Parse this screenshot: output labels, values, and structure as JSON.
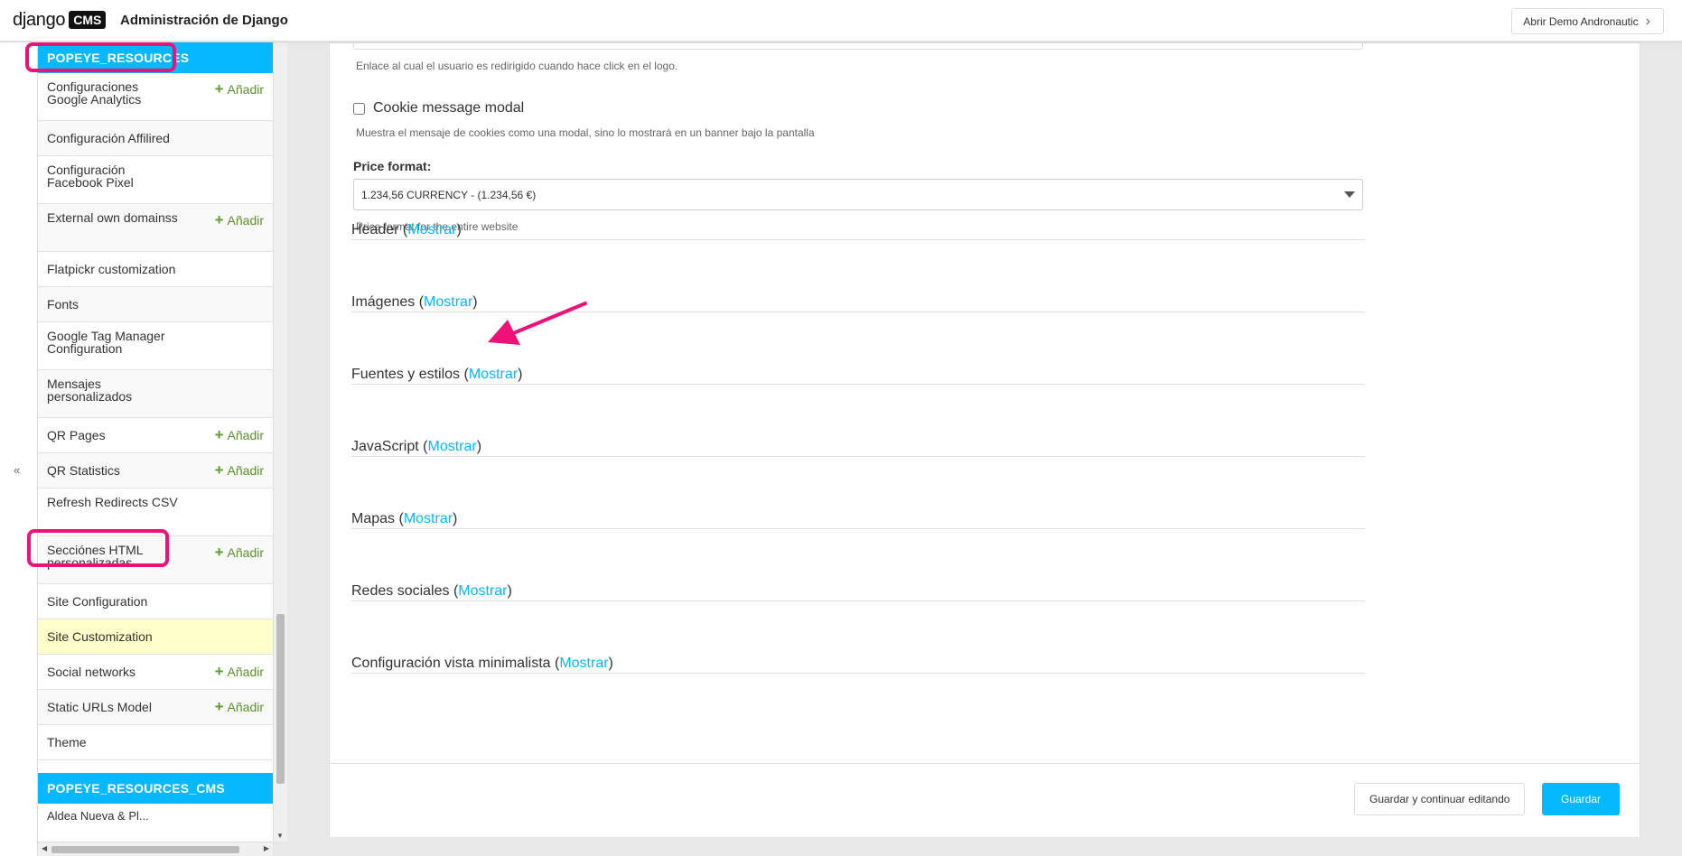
{
  "header": {
    "logo_text": "django",
    "logo_badge": "CMS",
    "title": "Administración de Django",
    "open_site_label": "Abrir Demo Andronautic",
    "open_site_icon": "chevron-right-icon"
  },
  "sidebar": {
    "collapse_label": "«",
    "add_label": "Añadir",
    "section1": {
      "caption": "POPEYE_RESOURCES",
      "items": [
        {
          "label": "Configuraciones Google Analytics",
          "add": true
        },
        {
          "label": "Configuración Affilired",
          "add": false
        },
        {
          "label": "Configuración Facebook Pixel",
          "add": false
        },
        {
          "label": "External own domainss",
          "add": true
        },
        {
          "label": "Flatpickr customization",
          "add": false
        },
        {
          "label": "Fonts",
          "add": false
        },
        {
          "label": "Google Tag Manager Configuration",
          "add": false
        },
        {
          "label": "Mensajes personalizados",
          "add": false
        },
        {
          "label": "QR Pages",
          "add": true
        },
        {
          "label": "QR Statistics",
          "add": true
        },
        {
          "label": "Refresh Redirects CSV",
          "add": false
        },
        {
          "label": "Secciónes HTML personalizadas",
          "add": true
        },
        {
          "label": "Site Configuration",
          "add": false
        },
        {
          "label": "Site Customization",
          "add": false,
          "active": true
        },
        {
          "label": "Social networks",
          "add": true
        },
        {
          "label": "Static URLs Model",
          "add": true
        },
        {
          "label": "Theme",
          "add": false
        }
      ]
    },
    "section2": {
      "caption": "POPEYE_RESOURCES_CMS",
      "partial_item": "Aldea Nueva & Pl..."
    }
  },
  "form": {
    "logo_link_help": "Enlace al cual el usuario es redirigido cuando hace click en el logo.",
    "cookie_label": "Cookie message modal",
    "cookie_checked": false,
    "cookie_help": "Muestra el mensaje de cookies como una modal, sino lo mostrará en un banner bajo la pantalla",
    "price_format_label": "Price format:",
    "price_format_value": "1.234,56 CURRENCY - (1.234,56 €)",
    "price_format_help": "Price format for the entire website",
    "show_label": "Mostrar",
    "fieldsets": [
      {
        "name": "Header"
      },
      {
        "name": "Imágenes"
      },
      {
        "name": "Fuentes y estilos"
      },
      {
        "name": "JavaScript"
      },
      {
        "name": "Mapas"
      },
      {
        "name": "Redes sociales"
      },
      {
        "name": "Configuración vista minimalista"
      }
    ]
  },
  "actions": {
    "save_continue": "Guardar y continuar editando",
    "save": "Guardar"
  },
  "colors": {
    "accent": "#06b8ff",
    "annotation": "#ee1278",
    "active_row": "#ffffcc",
    "add_green": "#5b8f2d"
  }
}
